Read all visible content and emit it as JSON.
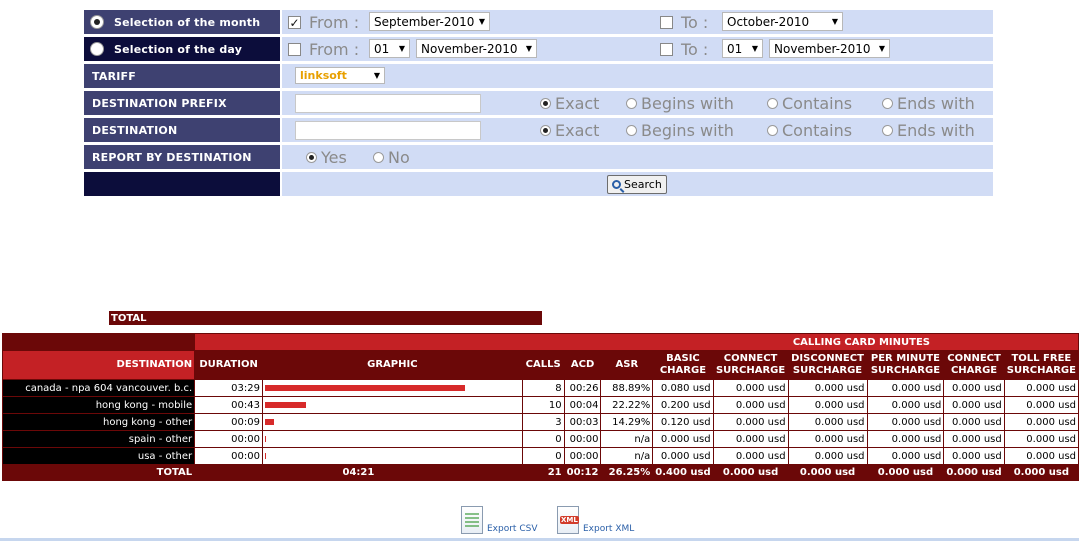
{
  "form": {
    "row_month": {
      "label": "Selection of the month",
      "from_label": "From :",
      "from_value": "September-2010",
      "to_label": "To :",
      "to_value": "October-2010"
    },
    "row_day": {
      "label": "Selection of the day",
      "from_label": "From :",
      "from_day": "01",
      "from_month": "November-2010",
      "to_label": "To :",
      "to_day": "01",
      "to_month": "November-2010"
    },
    "tariff": {
      "label": "TARIFF",
      "value": "linksoft"
    },
    "dest_prefix": {
      "label": "DESTINATION PREFIX",
      "value": "",
      "options": [
        "Exact",
        "Begins with",
        "Contains",
        "Ends with"
      ],
      "selected": "Exact"
    },
    "destination": {
      "label": "DESTINATION",
      "value": "",
      "options": [
        "Exact",
        "Begins with",
        "Contains",
        "Ends with"
      ],
      "selected": "Exact"
    },
    "report_by_dest": {
      "label": "REPORT BY DESTINATION",
      "options": [
        "Yes",
        "No"
      ],
      "selected": "Yes"
    },
    "search_label": "Search"
  },
  "report": {
    "total_bar_label": "TOTAL",
    "group_header": "CALLING CARD MINUTES",
    "columns": [
      "DESTINATION",
      "DURATION",
      "GRAPHIC",
      "CALLS",
      "ACD",
      "ASR",
      "BASIC CHARGE",
      "CONNECT SURCHARGE",
      "DISCONNECT SURCHARGE",
      "PER MINUTE SURCHARGE",
      "CONNECT CHARGE",
      "TOLL FREE SURCHARGE"
    ],
    "rows": [
      {
        "destination": "canada - npa 604 vancouver. b.c.",
        "duration": "03:29",
        "graph_fraction": 1.0,
        "calls": "8",
        "acd": "00:26",
        "asr": "88.89%",
        "basic": "0.080 usd",
        "connect_sur": "0.000 usd",
        "disconnect_sur": "0.000 usd",
        "per_min_sur": "0.000 usd",
        "connect_charge": "0.000 usd",
        "toll_free_sur": "0.000 usd"
      },
      {
        "destination": "hong kong - mobile",
        "duration": "00:43",
        "graph_fraction": 0.206,
        "calls": "10",
        "acd": "00:04",
        "asr": "22.22%",
        "basic": "0.200 usd",
        "connect_sur": "0.000 usd",
        "disconnect_sur": "0.000 usd",
        "per_min_sur": "0.000 usd",
        "connect_charge": "0.000 usd",
        "toll_free_sur": "0.000 usd"
      },
      {
        "destination": "hong kong - other",
        "duration": "00:09",
        "graph_fraction": 0.043,
        "calls": "3",
        "acd": "00:03",
        "asr": "14.29%",
        "basic": "0.120 usd",
        "connect_sur": "0.000 usd",
        "disconnect_sur": "0.000 usd",
        "per_min_sur": "0.000 usd",
        "connect_charge": "0.000 usd",
        "toll_free_sur": "0.000 usd"
      },
      {
        "destination": "spain - other",
        "duration": "00:00",
        "graph_fraction": 0.0,
        "calls": "0",
        "acd": "00:00",
        "asr": "n/a",
        "basic": "0.000 usd",
        "connect_sur": "0.000 usd",
        "disconnect_sur": "0.000 usd",
        "per_min_sur": "0.000 usd",
        "connect_charge": "0.000 usd",
        "toll_free_sur": "0.000 usd"
      },
      {
        "destination": "usa - other",
        "duration": "00:00",
        "graph_fraction": 0.0,
        "calls": "0",
        "acd": "00:00",
        "asr": "n/a",
        "basic": "0.000 usd",
        "connect_sur": "0.000 usd",
        "disconnect_sur": "0.000 usd",
        "per_min_sur": "0.000 usd",
        "connect_charge": "0.000 usd",
        "toll_free_sur": "0.000 usd"
      }
    ],
    "total": {
      "label": "TOTAL",
      "duration": "04:21",
      "calls": "21",
      "acd": "00:12",
      "asr": "26.25%",
      "basic": "0.400 usd",
      "connect_sur": "0.000 usd",
      "disconnect_sur": "0.000 usd",
      "per_min_sur": "0.000 usd",
      "connect_charge": "0.000 usd",
      "toll_free_sur": "0.000 usd"
    }
  },
  "export": {
    "csv_label": "Export CSV",
    "xml_label": "Export XML"
  },
  "colors": {
    "label_bg": "#3e4171",
    "label_bg_dark": "#0c0d3b",
    "form_bg": "#d1dcf5",
    "header_red": "#c42125",
    "header_dark": "#6b0808",
    "bar_red": "#d72a2a"
  }
}
